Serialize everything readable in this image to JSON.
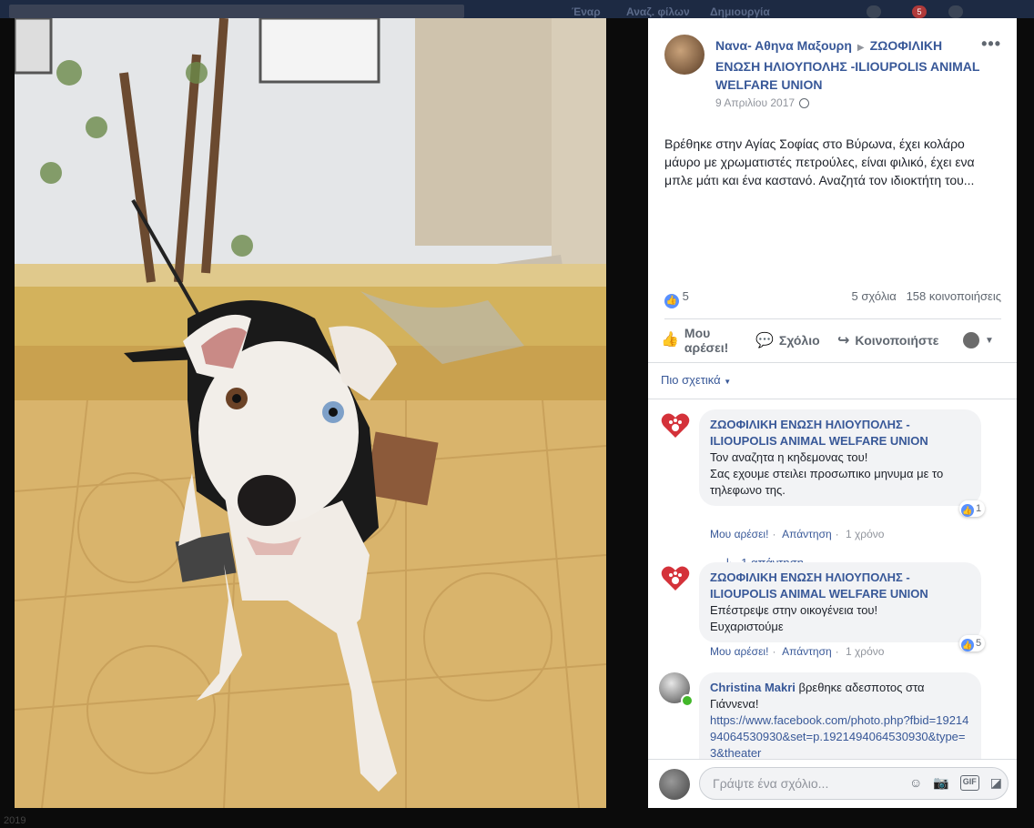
{
  "post": {
    "author": "Νανα- Αθηνα Μαξουρη",
    "target": "ΖΩΟΦΙΛΙΚΗ ΕΝΩΣΗ ΗΛΙΟΥΠΟΛΗΣ -ILIOUPOLIS ANIMAL WELFARE UNION",
    "date": "9 Απριλίου 2017",
    "text": "Βρέθηκε στην Αγίας Σοφίας στο Βύρωνα, έχει κολάρο μάυρο με χρωματιστές πετρούλες, είναι φιλικό, έχει ενα μπλε μάτι και ένα καστανό. Αναζητά τον ιδιοκτήτη του...",
    "like_count": "5",
    "comments_count": "5 σχόλια",
    "shares_count": "158 κοινοποιήσεις"
  },
  "actions": {
    "like": "Μου αρέσει!",
    "comment": "Σχόλιο",
    "share": "Κοινοποιήστε"
  },
  "filter": "Πιο σχετικά",
  "comments": [
    {
      "author": "ΖΩΟΦΙΛΙΚΗ ΕΝΩΣΗ ΗΛΙΟΥΠΟΛΗΣ -ILIOUPOLIS ANIMAL WELFARE UNION",
      "line1": "Τον αναζητα η κηδεμονας του!",
      "line2": "Σας εχουμε στειλει προσωπικο μηνυμα με το τηλεφωνο της.",
      "like": "Μου αρέσει!",
      "reply": "Απάντηση",
      "time": "1 χρόνο",
      "reactions": "1",
      "replies": "1 απάντηση"
    },
    {
      "author": "ΖΩΟΦΙΛΙΚΗ ΕΝΩΣΗ ΗΛΙΟΥΠΟΛΗΣ -ILIOUPOLIS ANIMAL WELFARE UNION",
      "line1": "Επέστρεψε στην οικογένεια του!",
      "line2": "Ευχαριστούμε",
      "like": "Μου αρέσει!",
      "reply": "Απάντηση",
      "time": "1 χρόνο",
      "reactions": "5"
    },
    {
      "author": "Christina Makri",
      "text": "βρεθηκε αδεσποτος στα Γιάννενα!",
      "link": "https://www.facebook.com/photo.php?fbid=192149406453​0930&set=p.1921494064530930&type=3&theater"
    }
  ],
  "composer": {
    "placeholder": "Γράψτε ένα σχόλιο..."
  },
  "background": {
    "nav_home": "Έναρ",
    "nav_find": "Αναζ. φίλων",
    "nav_create": "Δημιουργία",
    "notif_count": "5",
    "year": "2019"
  },
  "colors": {
    "link": "#385898",
    "like_blue": "#5890ff",
    "heart_red": "#d4323a"
  }
}
